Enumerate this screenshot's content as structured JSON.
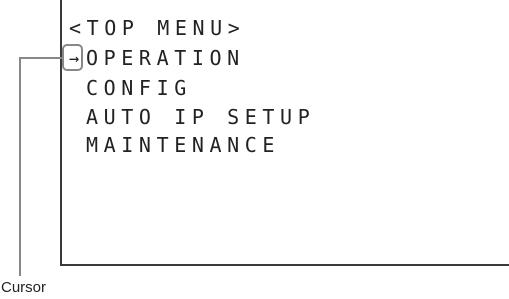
{
  "menu": {
    "title": "<TOP MENU>",
    "cursor_glyph": "→",
    "items": [
      {
        "label": "OPERATION",
        "selected": true
      },
      {
        "label": "CONFIG",
        "selected": false
      },
      {
        "label": "AUTO IP SETUP",
        "selected": false
      },
      {
        "label": "MAINTENANCE",
        "selected": false
      }
    ]
  },
  "annotation": {
    "cursor_label": "Cursor"
  },
  "colors": {
    "text": "#222222",
    "frame": "#3a3a3a",
    "callout": "#888888"
  }
}
